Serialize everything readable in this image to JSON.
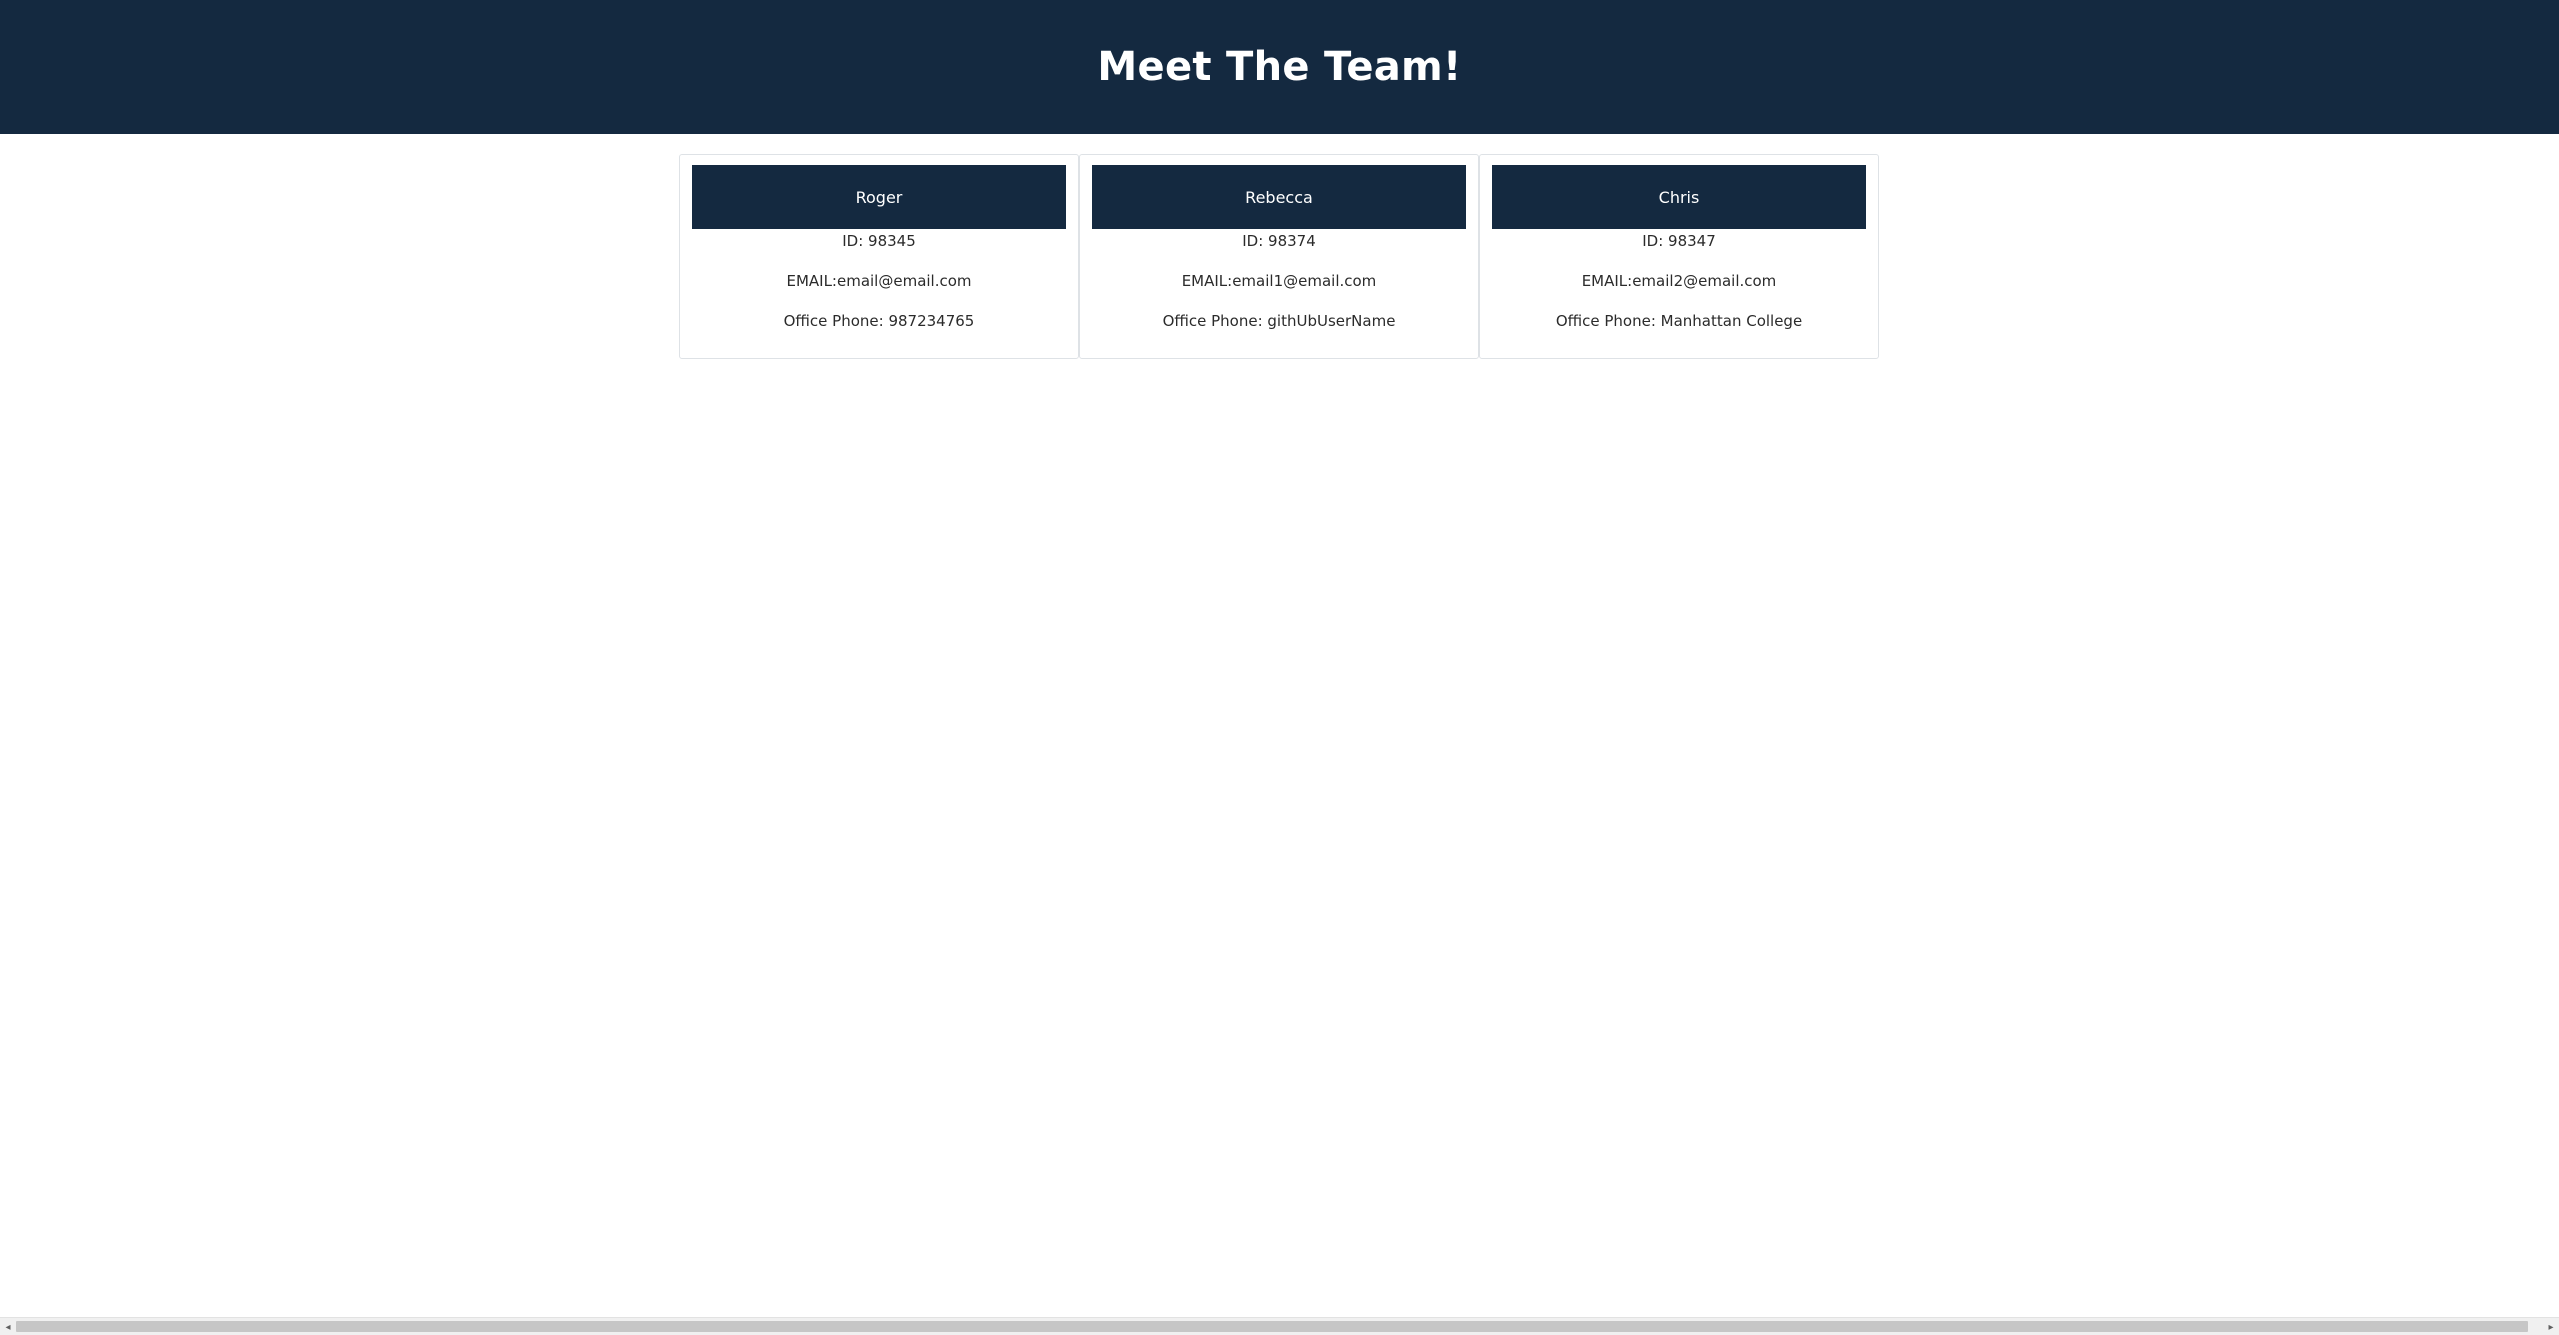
{
  "header": {
    "title": "Meet The Team!"
  },
  "team": [
    {
      "name": "Roger",
      "id_line": "ID: 98345",
      "email_line": "EMAIL:email@email.com",
      "extra_line": "Office Phone: 987234765"
    },
    {
      "name": "Rebecca",
      "id_line": "ID: 98374",
      "email_line": "EMAIL:email1@email.com",
      "extra_line": "Office Phone: githUbUserName"
    },
    {
      "name": "Chris",
      "id_line": "ID: 98347",
      "email_line": "EMAIL:email2@email.com",
      "extra_line": "Office Phone: Manhattan College"
    }
  ],
  "scrollbar": {
    "left_arrow": "◂",
    "right_arrow": "▸"
  },
  "colors": {
    "header_bg": "#142940",
    "card_border": "#dee2e6"
  }
}
